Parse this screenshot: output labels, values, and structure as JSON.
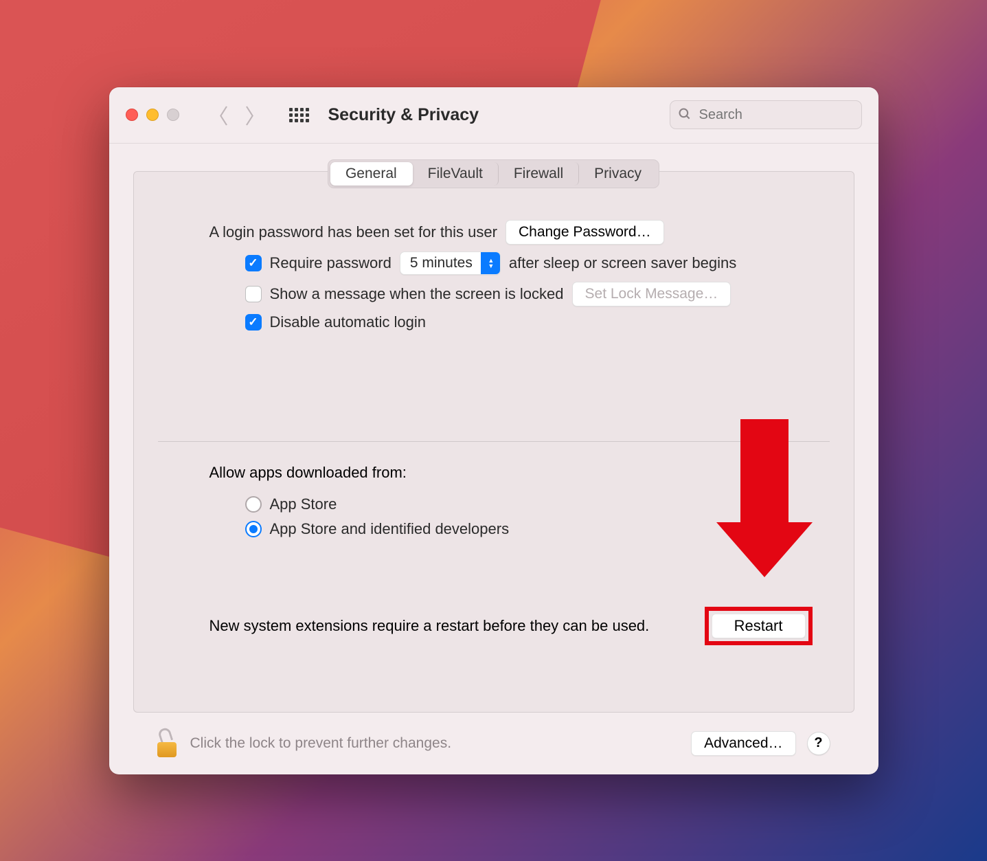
{
  "window": {
    "title": "Security & Privacy"
  },
  "search": {
    "placeholder": "Search"
  },
  "tabs": {
    "general": "General",
    "filevault": "FileVault",
    "firewall": "Firewall",
    "privacy": "Privacy"
  },
  "login": {
    "text": "A login password has been set for this user",
    "change_btn": "Change Password…",
    "require_label": "Require password",
    "delay_value": "5 minutes",
    "after_text": "after sleep or screen saver begins",
    "show_message_label": "Show a message when the screen is locked",
    "set_lock_btn": "Set Lock Message…",
    "disable_auto_label": "Disable automatic login",
    "require_checked": true,
    "show_message_checked": false,
    "disable_auto_checked": true
  },
  "allow": {
    "heading": "Allow apps downloaded from:",
    "opt1": "App Store",
    "opt2": "App Store and identified developers",
    "selected": "opt2"
  },
  "restart": {
    "message": "New system extensions require a restart before they can be used.",
    "button": "Restart"
  },
  "footer": {
    "text": "Click the lock to prevent further changes.",
    "advanced": "Advanced…",
    "help": "?"
  }
}
